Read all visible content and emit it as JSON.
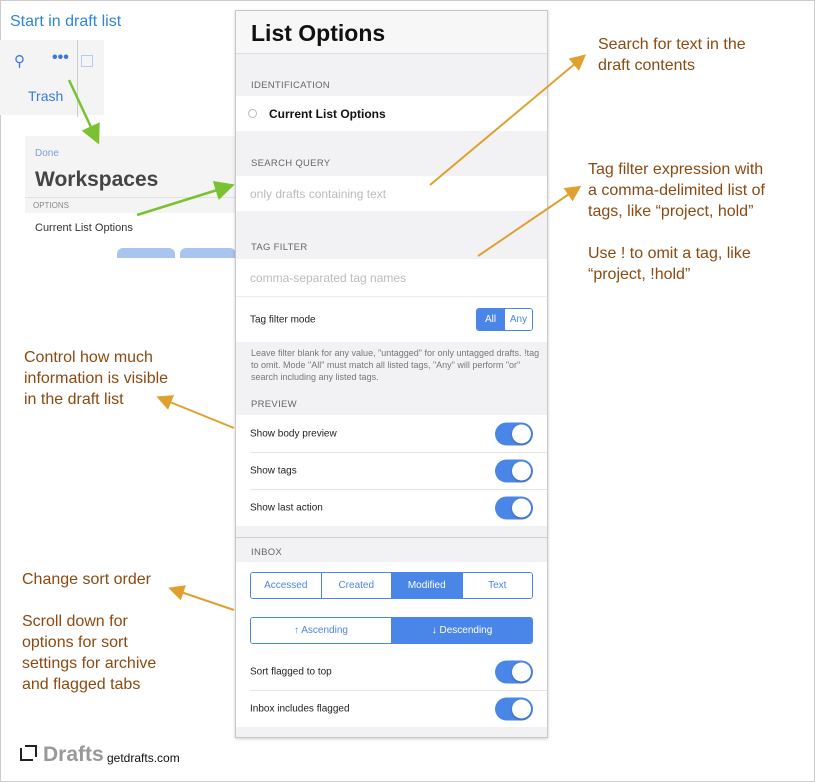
{
  "annotations": {
    "start": "Start in draft list",
    "search": "Search for text in the\ndraft contents",
    "tag": "Tag filter expression with\na comma-delimited list of\ntags, like “project, hold”\n\nUse ! to omit a tag, like\n“project, !hold”",
    "control": "Control how much\ninformation is visible\nin the draft list",
    "sort": "Change sort order\n\nScroll down for\noptions for sort\nsettings for archive\nand flagged tabs"
  },
  "draft_list": {
    "trash_label": "Trash",
    "search_icon": "search-icon",
    "more_icon": "ellipsis-icon"
  },
  "workspaces": {
    "done_label": "Done",
    "title": "Workspaces",
    "section": "OPTIONS",
    "item": "Current List Options"
  },
  "panel": {
    "title": "List Options",
    "identification": {
      "header": "IDENTIFICATION",
      "item": "Current List Options"
    },
    "search_query": {
      "header": "SEARCH QUERY",
      "placeholder": "only drafts containing text"
    },
    "tag_filter": {
      "header": "TAG FILTER",
      "placeholder": "comma-separated tag names",
      "mode_label": "Tag filter mode",
      "modes": [
        "All",
        "Any"
      ],
      "selected_mode": "All",
      "help": "Leave filter blank for any value, \"untagged\" for only untagged drafts. !tag to omit. Mode \"All\" must match all listed tags, \"Any\" will perform \"or\" search including any listed tags."
    },
    "preview": {
      "header": "PREVIEW",
      "items": [
        {
          "label": "Show body preview",
          "on": true
        },
        {
          "label": "Show tags",
          "on": true
        },
        {
          "label": "Show last action",
          "on": true
        }
      ]
    },
    "inbox": {
      "header": "INBOX",
      "sort_fields": [
        "Accessed",
        "Created",
        "Modified",
        "Text"
      ],
      "selected_sort_field": "Modified",
      "sort_orders": [
        "↑ Ascending",
        "↓ Descending"
      ],
      "selected_sort_order": "↓ Descending",
      "items": [
        {
          "label": "Sort flagged to top",
          "on": true
        },
        {
          "label": "Inbox includes flagged",
          "on": true
        }
      ]
    }
  },
  "footer": {
    "brand": "Drafts",
    "url": "getdrafts.com"
  },
  "colors": {
    "accent": "#4a86e8",
    "annotation": "#8a4a12",
    "arrow_orange": "#e0a030",
    "arrow_green": "#7ac231"
  }
}
